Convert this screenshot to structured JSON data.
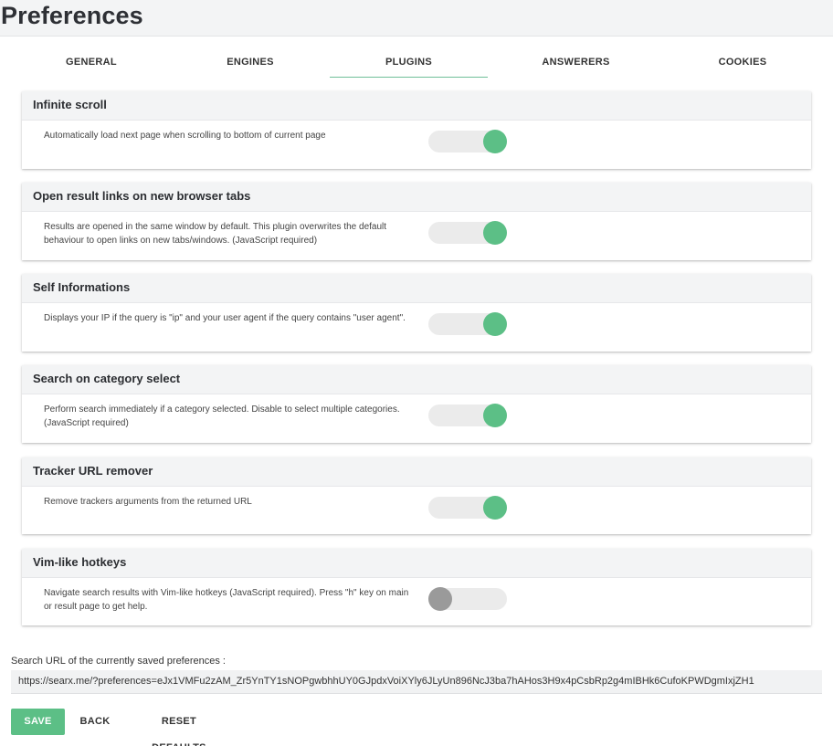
{
  "header": {
    "title": "Preferences"
  },
  "tabs": [
    {
      "label": "GENERAL",
      "active": false
    },
    {
      "label": "ENGINES",
      "active": false
    },
    {
      "label": "PLUGINS",
      "active": true
    },
    {
      "label": "ANSWERERS",
      "active": false
    },
    {
      "label": "COOKIES",
      "active": false
    }
  ],
  "plugins": [
    {
      "title": "Infinite scroll",
      "description": "Automatically load next page when scrolling to bottom of current page",
      "enabled": true
    },
    {
      "title": "Open result links on new browser tabs",
      "description": "Results are opened in the same window by default. This plugin overwrites the default behaviour to open links on new tabs/windows. (JavaScript required)",
      "enabled": true
    },
    {
      "title": "Self Informations",
      "description": "Displays your IP if the query is \"ip\" and your user agent if the query contains \"user agent\".",
      "enabled": true
    },
    {
      "title": "Search on category select",
      "description": "Perform search immediately if a category selected. Disable to select multiple categories. (JavaScript required)",
      "enabled": true
    },
    {
      "title": "Tracker URL remover",
      "description": "Remove trackers arguments from the returned URL",
      "enabled": true
    },
    {
      "title": "Vim-like hotkeys",
      "description": "Navigate search results with Vim-like hotkeys (JavaScript required). Press \"h\" key on main or result page to get help.",
      "enabled": false
    }
  ],
  "search_url": {
    "label": "Search URL of the currently saved preferences :",
    "value": "https://searx.me/?preferences=eJx1VMFu2zAM_Zr5YnTY1sNOPgwbhhUY0GJpdxVoiXYly6JLyUn896NcJ3ba7hAHos3H9x4pCsbRp2g4mIBHk6CufoKPWDgmIxjZH1"
  },
  "buttons": {
    "save": "SAVE",
    "back": "BACK",
    "reset": "RESET DEFAULTS"
  },
  "colors": {
    "accent": "#5cbf86",
    "toggle_off_knob": "#9a9a9a",
    "tab_underline": "#6fbf98"
  }
}
